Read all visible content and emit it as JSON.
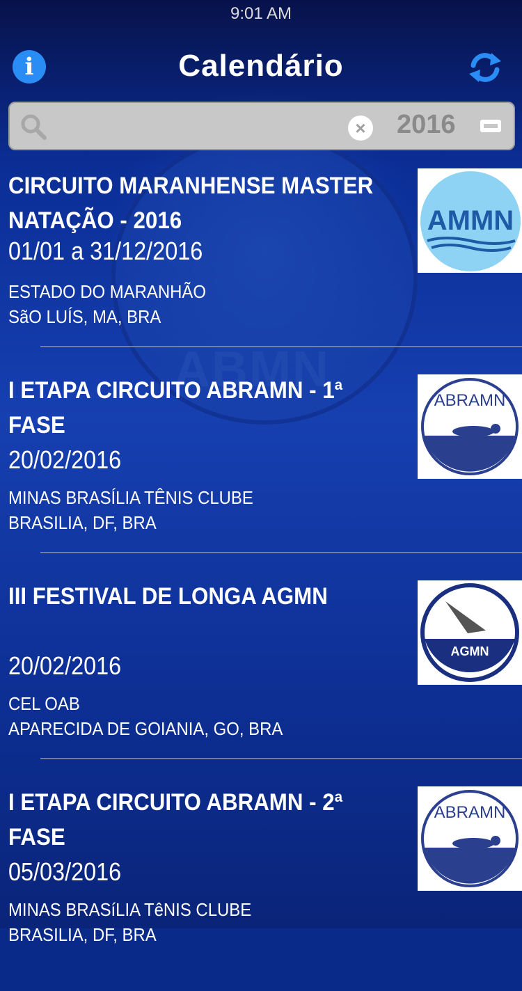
{
  "status_bar": {
    "time": "9:01 AM"
  },
  "nav": {
    "title": "Calendário",
    "info_icon": "info-icon",
    "refresh_icon": "refresh-icon"
  },
  "search": {
    "value": "",
    "year": "2016",
    "accent": "#c8c8c8"
  },
  "events": [
    {
      "title": "CIRCUITO MARANHENSE MASTER NATAÇÃO - 2016",
      "date": "01/01 a 31/12/2016",
      "venue": "ESTADO DO MARANHÃO",
      "city": "SãO LUÍS, MA, BRA",
      "logo": "AMMN"
    },
    {
      "title": "I ETAPA CIRCUITO ABRAMN - 1ª FASE",
      "date": "20/02/2016",
      "venue": "MINAS BRASÍLIA TÊNIS CLUBE",
      "city": "BRASILIA, DF, BRA",
      "logo": "ABRAMN"
    },
    {
      "title": "III FESTIVAL DE LONGA AGMN",
      "date": "20/02/2016",
      "venue": "CEL OAB",
      "city": "APARECIDA DE GOIANIA, GO, BRA",
      "logo": "AGMN"
    },
    {
      "title": "I ETAPA CIRCUITO ABRAMN - 2ª FASE",
      "date": "05/03/2016",
      "venue": "MINAS BRASíLIA TêNIS CLUBE",
      "city": "BRASILIA, DF, BRA",
      "logo": "ABRAMN"
    }
  ]
}
